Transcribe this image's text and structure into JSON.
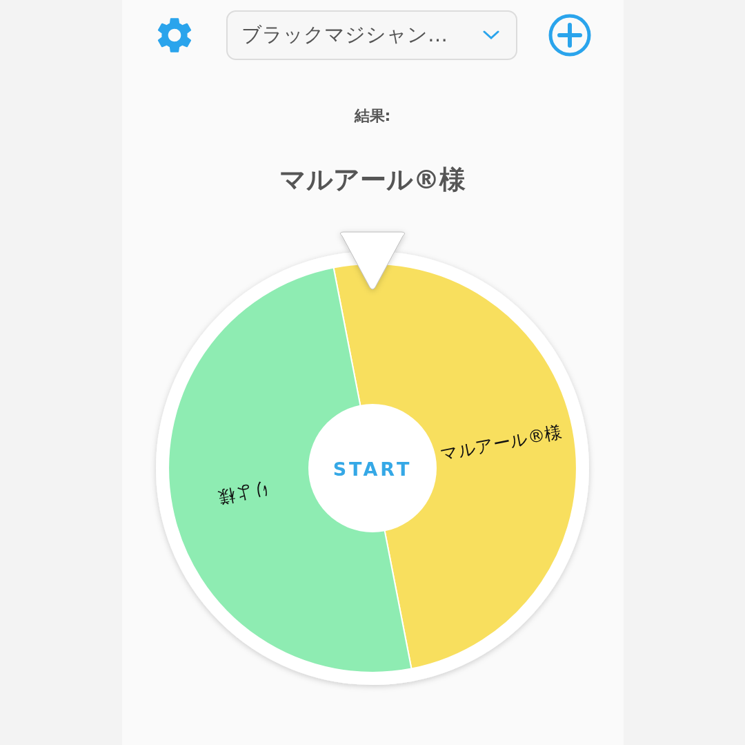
{
  "toolbar": {
    "selected_wheel": "ブラックマジシャン…"
  },
  "result": {
    "label": "結果:",
    "value": "マルアール®様"
  },
  "wheel": {
    "start_label": "START",
    "segments": [
      {
        "label": "マルアール®様",
        "color": "#f8df5e"
      },
      {
        "label": "りよ様",
        "color": "#8eecb2"
      }
    ]
  }
}
